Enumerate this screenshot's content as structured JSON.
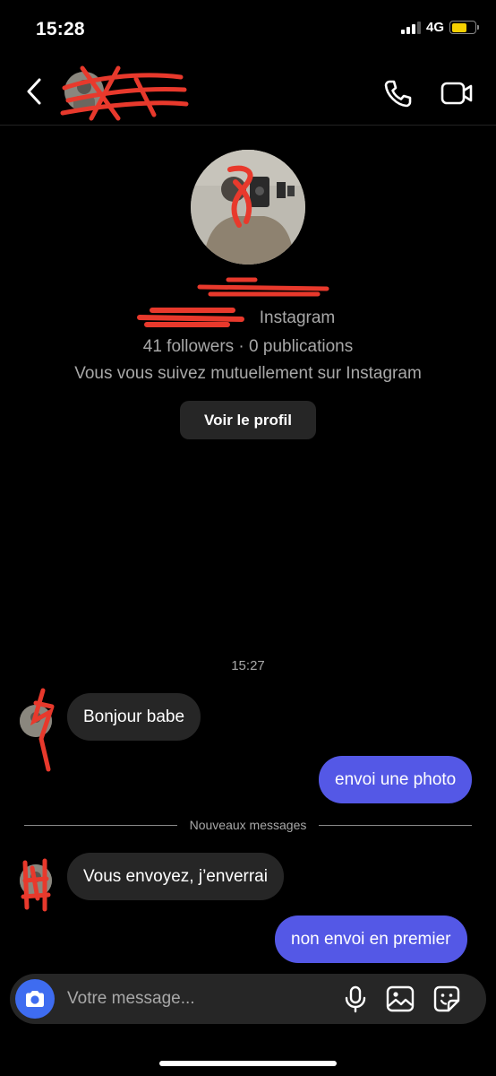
{
  "status_bar": {
    "time": "15:28",
    "network": "4G",
    "signal_bars_filled": 3,
    "signal_bars_total": 4,
    "battery_level": 0.65,
    "battery_color": "#f5d000"
  },
  "header": {
    "back_icon": "chevron-left-icon",
    "contact_name": "",
    "call_icon": "phone-icon",
    "video_icon": "video-camera-icon"
  },
  "profile": {
    "username": "",
    "platform_line": "Instagram",
    "stats_line": "41 followers · 0 publications",
    "mutual_line": "Vous vous suivez mutuellement sur Instagram",
    "view_profile_label": "Voir le profil"
  },
  "conversation": {
    "timestamp": "15:27",
    "new_messages_label": "Nouveaux messages",
    "messages": [
      {
        "direction": "incoming",
        "text": "Bonjour babe"
      },
      {
        "direction": "outgoing",
        "text": "envoi une photo"
      },
      {
        "direction": "incoming",
        "text": "Vous envoyez, j’enverrai"
      },
      {
        "direction": "outgoing",
        "text": "non envoi en premier"
      }
    ]
  },
  "composer": {
    "placeholder": "Votre message...",
    "camera_icon": "camera-icon",
    "mic_icon": "microphone-icon",
    "gallery_icon": "image-icon",
    "sticker_icon": "sticker-icon"
  },
  "colors": {
    "background": "#000000",
    "incoming_bubble": "#262626",
    "outgoing_bubble": "#5458e6",
    "camera_button": "#3e6cf0",
    "redaction": "#e8392c"
  }
}
